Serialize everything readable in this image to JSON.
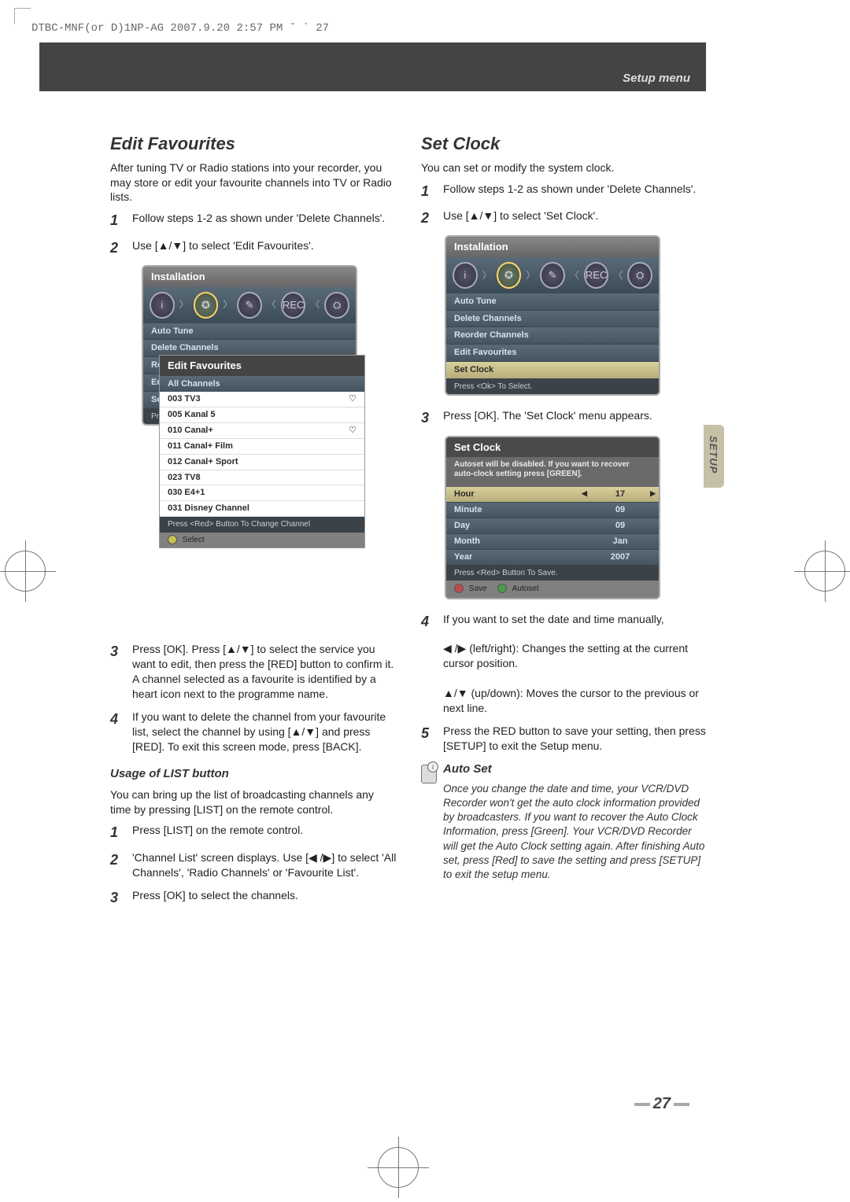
{
  "header": {
    "docinfo": "DTBC-MNF(or D)1NP-AG  2007.9.20 2:57 PM  ˘  `  27",
    "section": "Setup menu"
  },
  "sideTab": "SETUP",
  "pageNumber": "27",
  "left": {
    "title": "Edit Favourites",
    "intro": "After tuning TV or Radio stations into your recorder, you may store or edit your favourite channels into TV or Radio lists.",
    "steps12": [
      "Follow steps 1-2 as shown under 'Delete Channels'.",
      "Use [▲/▼] to select 'Edit Favourites'."
    ],
    "panel": {
      "title": "Installation",
      "items": [
        "Auto Tune",
        "Delete Channels",
        "Reorder Channels",
        "Edit Favourites",
        "Set Clock"
      ],
      "footLeft": "Pres",
      "sub": {
        "title": "Edit Favourites",
        "header": "All Channels",
        "rows": [
          {
            "t": "003 TV3",
            "h": true
          },
          {
            "t": "005 Kanal 5",
            "h": false
          },
          {
            "t": "010 Canal+",
            "h": true
          },
          {
            "t": "011 Canal+ Film",
            "h": false
          },
          {
            "t": "012 Canal+ Sport",
            "h": false
          },
          {
            "t": "023 TV8",
            "h": false
          },
          {
            "t": "030 E4+1",
            "h": false
          },
          {
            "t": "031 Disney Channel",
            "h": false
          }
        ],
        "foot": "Press <Red> Button To Change Channel",
        "select": "Select"
      }
    },
    "steps34": [
      "Press [OK]. Press [▲/▼] to select the service you want to edit, then press the [RED] button to confirm it. A channel selected as a favourite is identified by a heart icon next to the programme name.",
      "If you want to delete the channel from your favourite list, select the channel by using [▲/▼] and press [RED]. To exit this screen mode, press [BACK]."
    ],
    "listUsage": {
      "title": "Usage of LIST button",
      "intro": "You can bring up the list of broadcasting channels any time by pressing [LIST] on the remote control.",
      "steps": [
        "Press [LIST] on the remote control.",
        "'Channel List' screen displays. Use [◀ /▶] to select 'All Channels', 'Radio Channels' or 'Favourite List'.",
        "Press [OK] to select the channels."
      ]
    }
  },
  "right": {
    "title": "Set Clock",
    "intro": "You can set or modify the system clock.",
    "steps12": [
      "Follow steps 1-2 as shown under 'Delete Channels'.",
      "Use [▲/▼] to select 'Set Clock'."
    ],
    "panel": {
      "title": "Installation",
      "items": [
        "Auto Tune",
        "Delete Channels",
        "Reorder Channels",
        "Edit Favourites",
        "Set Clock"
      ],
      "highlight": "Set Clock",
      "foot": "Press <Ok> To Select."
    },
    "step3": "Press [OK].  The 'Set Clock' menu appears.",
    "setclock": {
      "title": "Set Clock",
      "note": "Autoset will be disabled. If you want to recover auto-clock setting press [GREEN].",
      "rows": [
        {
          "lab": "Hour",
          "val": "17",
          "hl": true
        },
        {
          "lab": "Minute",
          "val": "09",
          "hl": false
        },
        {
          "lab": "Day",
          "val": "09",
          "hl": false
        },
        {
          "lab": "Month",
          "val": "Jan",
          "hl": false
        },
        {
          "lab": "Year",
          "val": "2007",
          "hl": false
        }
      ],
      "foot": "Press <Red> Button To Save.",
      "btnSave": "Save",
      "btnAutoset": "Autoset"
    },
    "step4": {
      "lead": "If you want to set the date and time manually,",
      "lines": [
        "◀ /▶ (left/right): Changes the setting at the current cursor position.",
        "▲/▼ (up/down): Moves the cursor to the previous or next line."
      ]
    },
    "step5": "Press the RED button to save your setting, then press [SETUP] to exit the Setup menu.",
    "autoset": {
      "title": "Auto Set",
      "body": "Once you change the date and time, your VCR/DVD Recorder won't get the auto clock information provided by broadcasters. If you want to recover the Auto Clock Information, press [Green]. Your VCR/DVD Recorder will get the Auto Clock setting again. After finishing Auto set, press [Red] to save the setting and press [SETUP] to exit the setup menu."
    }
  }
}
